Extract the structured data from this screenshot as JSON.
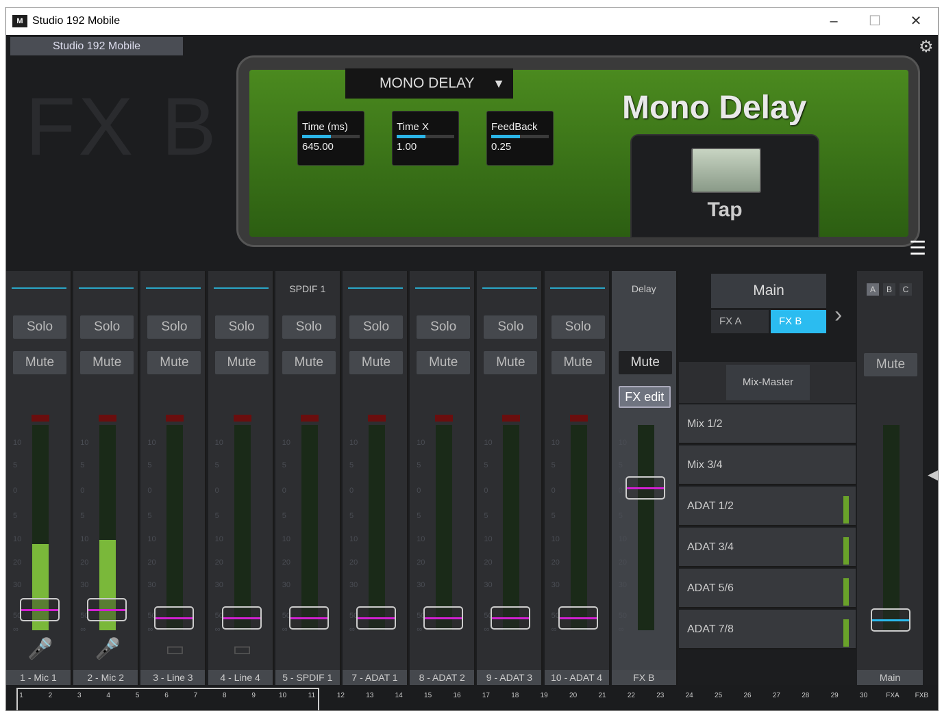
{
  "window": {
    "title": "Studio 192 Mobile",
    "min": "–",
    "max": "☐",
    "close": "✕"
  },
  "device_tab": "Studio 192 Mobile",
  "fx_title": "FX B",
  "plugin": {
    "preset": "MONO DELAY",
    "name": "Mono Delay",
    "tap": "Tap",
    "params": [
      {
        "label": "Time (ms)",
        "value": "645.00",
        "level": 0.5
      },
      {
        "label": "Time X",
        "value": "1.00",
        "level": 0.5
      },
      {
        "label": "FeedBack",
        "value": "0.25",
        "level": 0.5
      }
    ]
  },
  "channels": [
    {
      "name": "1 - Mic 1",
      "solo": "Solo",
      "mute": "Mute",
      "src": "mic",
      "level": 0.42
    },
    {
      "name": "2 - Mic 2",
      "solo": "Solo",
      "mute": "Mute",
      "src": "mic",
      "level": 0.44
    },
    {
      "name": "3 - Line 3",
      "solo": "Solo",
      "mute": "Mute",
      "src": "line",
      "level": 0
    },
    {
      "name": "4 - Line 4",
      "solo": "Solo",
      "mute": "Mute",
      "src": "line",
      "level": 0
    },
    {
      "name": "5 - SPDIF 1",
      "solo": "Solo",
      "mute": "Mute",
      "src": "SPDIF 1",
      "level": 0
    },
    {
      "name": "7 - ADAT 1",
      "solo": "Solo",
      "mute": "Mute",
      "src": "",
      "level": 0
    },
    {
      "name": "8 - ADAT 2",
      "solo": "Solo",
      "mute": "Mute",
      "src": "",
      "level": 0
    },
    {
      "name": "9 - ADAT 3",
      "solo": "Solo",
      "mute": "Mute",
      "src": "",
      "level": 0
    },
    {
      "name": "10 - ADAT 4",
      "solo": "Solo",
      "mute": "Mute",
      "src": "",
      "level": 0
    }
  ],
  "fx_strip": {
    "label": "Delay",
    "mute": "Mute",
    "edit": "FX edit",
    "name": "FX B"
  },
  "scale": [
    "10",
    "5",
    "0",
    "5",
    "10",
    "20",
    "30",
    "50",
    "∞"
  ],
  "mix": {
    "main": "Main",
    "fxa": "FX A",
    "fxb": "FX B",
    "mixmaster": "Mix-Master",
    "outputs": [
      "Mix 1/2",
      "Mix 3/4",
      "ADAT 1/2",
      "ADAT 3/4",
      "ADAT 5/6",
      "ADAT 7/8"
    ]
  },
  "main_strip": {
    "a": "A",
    "b": "B",
    "c": "C",
    "mute": "Mute",
    "name": "Main"
  },
  "ruler": [
    "1",
    "2",
    "3",
    "4",
    "5",
    "6",
    "7",
    "8",
    "9",
    "10",
    "11",
    "12",
    "13",
    "14",
    "15",
    "16",
    "17",
    "18",
    "19",
    "20",
    "21",
    "22",
    "23",
    "24",
    "25",
    "26",
    "27",
    "28",
    "29",
    "30",
    "FXA",
    "FXB"
  ]
}
